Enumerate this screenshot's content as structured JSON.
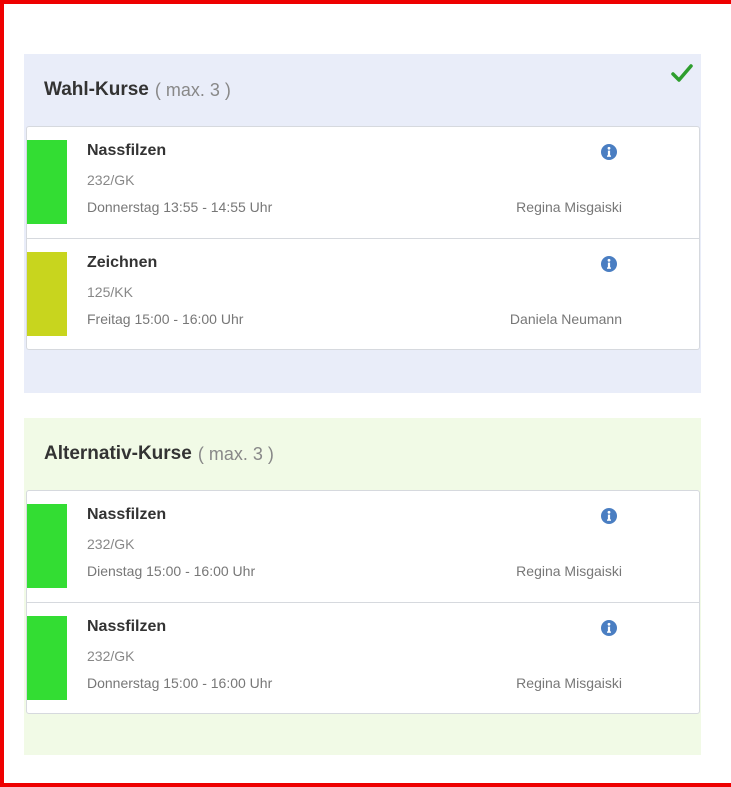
{
  "colors": {
    "frame_border": "#ee0000",
    "wahl_background": "#e9edf9",
    "alternativ_background": "#f1fae6",
    "status_green": "#33dd33",
    "status_yellow": "#c8d51e",
    "info_blue": "#4a7ec2",
    "check_green": "#2e9e2e"
  },
  "wahl": {
    "title": "Wahl-Kurse",
    "max": "( max. 3 )",
    "status_icon": "check-icon",
    "courses": [
      {
        "name": "Nassfilzen",
        "code": "232/GK",
        "time": "Donnerstag 13:55 - 14:55 Uhr",
        "teacher": "Regina Misgaiski",
        "status_color": "#33dd33",
        "icon": "info-icon"
      },
      {
        "name": "Zeichnen",
        "code": "125/KK",
        "time": "Freitag 15:00 - 16:00 Uhr",
        "teacher": "Daniela Neumann",
        "status_color": "#c8d51e",
        "icon": "info-icon"
      }
    ]
  },
  "alternativ": {
    "title": "Alternativ-Kurse",
    "max": "( max. 3 )",
    "courses": [
      {
        "name": "Nassfilzen",
        "code": "232/GK",
        "time": "Dienstag 15:00 - 16:00 Uhr",
        "teacher": "Regina Misgaiski",
        "status_color": "#33dd33",
        "icon": "info-icon"
      },
      {
        "name": "Nassfilzen",
        "code": "232/GK",
        "time": "Donnerstag 15:00 - 16:00 Uhr",
        "teacher": "Regina Misgaiski",
        "status_color": "#33dd33",
        "icon": "info-icon"
      }
    ]
  }
}
